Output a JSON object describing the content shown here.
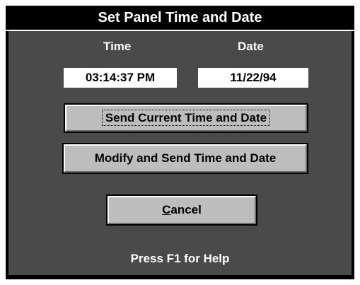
{
  "dialog": {
    "title": "Set Panel Time and Date",
    "time_label": "Time",
    "date_label": "Date",
    "time_value": "03:14:37 PM",
    "date_value": "11/22/94",
    "send_button_label": "Send Current Time and Date",
    "modify_button_label": "Modify and Send Time and Date",
    "cancel_button": {
      "mnemonic": "C",
      "rest": "ancel"
    },
    "help_text": "Press F1 for Help"
  },
  "colors": {
    "panel_background": "#4a4a4a",
    "title_background": "#000000",
    "button_face": "#bdbdbd"
  }
}
